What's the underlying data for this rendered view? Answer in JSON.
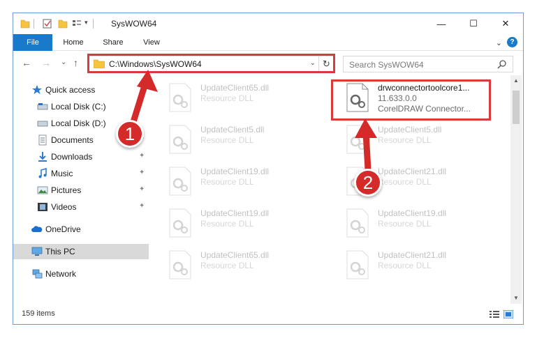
{
  "window": {
    "title": "SysWOW64",
    "minimize_glyph": "—",
    "maximize_glyph": "☐",
    "close_glyph": "✕"
  },
  "ribbon": {
    "tabs": [
      "File",
      "Home",
      "Share",
      "View"
    ],
    "expand_glyph": "⌄",
    "help_glyph": "?"
  },
  "address": {
    "path": "C:\\Windows\\SysWOW64",
    "dropdown_glyph": "⌄",
    "refresh_glyph": "↻"
  },
  "search": {
    "placeholder": "Search SysWOW64"
  },
  "nav": {
    "back_glyph": "←",
    "forward_glyph": "→",
    "recent_glyph": "⌄",
    "up_glyph": "↑",
    "items": [
      {
        "label": "Quick access",
        "icon": "star-icon"
      },
      {
        "label": "Local Disk (C:)",
        "icon": "drive-icon"
      },
      {
        "label": "Local Disk (D:)",
        "icon": "drive-icon"
      },
      {
        "label": "Documents",
        "icon": "documents-icon",
        "pinned": true
      },
      {
        "label": "Downloads",
        "icon": "downloads-icon",
        "pinned": true
      },
      {
        "label": "Music",
        "icon": "music-icon",
        "pinned": true
      },
      {
        "label": "Pictures",
        "icon": "pictures-icon",
        "pinned": true
      },
      {
        "label": "Videos",
        "icon": "videos-icon",
        "pinned": true
      },
      {
        "label": "OneDrive",
        "icon": "onedrive-icon"
      },
      {
        "label": "This PC",
        "icon": "pc-icon",
        "selected": true
      },
      {
        "label": "Network",
        "icon": "network-icon"
      }
    ],
    "pin_glyph": "📌"
  },
  "files": {
    "highlighted": {
      "name": "drwconnectortoolcore1...",
      "version": "11.633.0.0",
      "description": "CorelDRAW Connector..."
    },
    "items": [
      {
        "name": "UpdateClient65.dll",
        "type": "Resource DLL"
      },
      {
        "name": "UpdateClient5.dll",
        "type": "Resource DLL"
      },
      {
        "name": "UpdateClient5.dll",
        "type": "Resource DLL"
      },
      {
        "name": "UpdateClient19.dll",
        "type": "Resource DLL"
      },
      {
        "name": "UpdateClient21.dll",
        "type": "Resource DLL"
      },
      {
        "name": "UpdateClient19.dll",
        "type": "Resource DLL"
      },
      {
        "name": "UpdateClient19.dll",
        "type": "Resource DLL"
      },
      {
        "name": "UpdateClient65.dll",
        "type": "Resource DLL"
      },
      {
        "name": "UpdateClient21.dll",
        "type": "Resource DLL"
      }
    ]
  },
  "status": {
    "item_count": "159 items"
  },
  "annotations": {
    "step1": "1",
    "step2": "2",
    "color": "#d42a2a"
  }
}
